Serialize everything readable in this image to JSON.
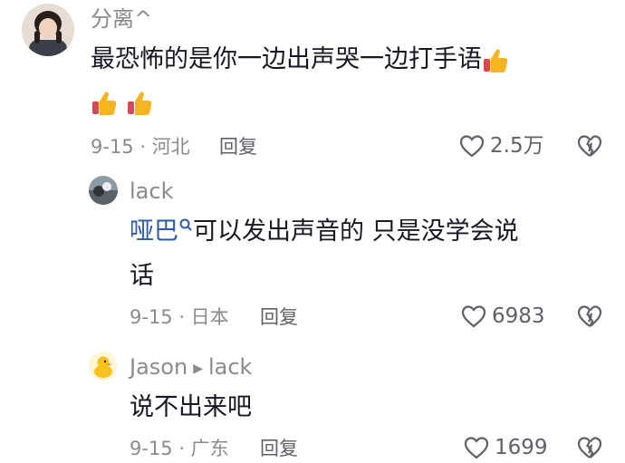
{
  "comments": [
    {
      "username": "分离^",
      "text": "最恐怖的是你一边出声哭一边打手语",
      "meta": "9-15 · 河北",
      "reply_label": "回复",
      "likes": "2.5万",
      "avatar_icon": "girl-photo-avatar"
    },
    {
      "username": "lack",
      "mention": "哑巴",
      "text": "可以发出声音的 只是没学会说",
      "text_line2": "话",
      "meta": "9-15 · 日本",
      "reply_label": "回复",
      "likes": "6983",
      "avatar_icon": "landscape-avatar"
    },
    {
      "username": "Jason",
      "reply_to": "lack",
      "text": "说不出来吧",
      "meta": "9-15 · 广东",
      "reply_label": "回复",
      "likes": "1699",
      "avatar_icon": "yellow-duck-avatar"
    }
  ],
  "colors": {
    "username": "#8a8b91",
    "text": "#161823",
    "mention": "#2a5aa8",
    "thumb_emoji": "#f5b522"
  }
}
